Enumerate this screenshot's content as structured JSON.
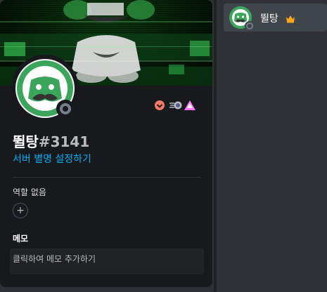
{
  "profile": {
    "username": "뛸탕",
    "discriminator": "#3141",
    "set_nickname_link": "서버 별명 설정하기",
    "roles_title": "역할 없음",
    "add_role_symbol": "+",
    "memo_title": "메모",
    "memo_placeholder": "클릭하여 메모 추가하기",
    "status": "offline",
    "badges": [
      "hypesquad-balance-badge",
      "nitro-boost-badge",
      "early-supporter-badge"
    ]
  },
  "member_list": {
    "items": [
      {
        "name": "뛸탕",
        "status": "offline",
        "owner": true
      }
    ]
  },
  "colors": {
    "background": "#2f3136",
    "popout": "#18191c",
    "link": "#00aff4",
    "banner_green": "#1f8a3a",
    "avatar_green": "#43b581",
    "crown": "#faa61a",
    "offline": "#747f8d"
  }
}
